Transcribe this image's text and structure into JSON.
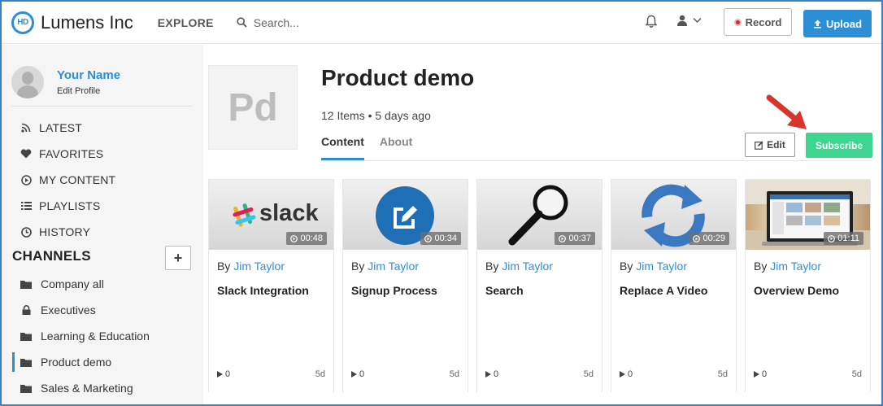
{
  "header": {
    "logo_text": "HD",
    "brand": "Lumens Inc",
    "explore_label": "EXPLORE",
    "search_placeholder": "Search...",
    "record_label": "Record",
    "upload_label": "Upload",
    "accent_color": "#2c8fd6"
  },
  "sidebar": {
    "profile": {
      "name": "Your Name",
      "edit_label": "Edit Profile"
    },
    "nav": [
      {
        "label": "LATEST",
        "icon": "rss-icon"
      },
      {
        "label": "FAVORITES",
        "icon": "heart-icon"
      },
      {
        "label": "MY CONTENT",
        "icon": "play-circle-icon"
      },
      {
        "label": "PLAYLISTS",
        "icon": "list-icon"
      },
      {
        "label": "HISTORY",
        "icon": "clock-icon"
      }
    ],
    "channels_title": "CHANNELS",
    "add_channel_label": "+",
    "channels": [
      {
        "label": "Company all",
        "icon": "folder-icon"
      },
      {
        "label": "Executives",
        "icon": "lock-icon"
      },
      {
        "label": "Learning & Education",
        "icon": "folder-icon"
      },
      {
        "label": "Product demo",
        "icon": "folder-icon",
        "active": true
      },
      {
        "label": "Sales & Marketing",
        "icon": "folder-icon"
      }
    ]
  },
  "playlist": {
    "thumb_text": "Pd",
    "title": "Product demo",
    "meta": "12 Items • 5 days ago",
    "tabs": [
      {
        "label": "Content",
        "active": true
      },
      {
        "label": "About",
        "active": false
      }
    ],
    "edit_label": "Edit",
    "subscribe_label": "Subscribe",
    "subscribe_color": "#3dd590"
  },
  "cards": [
    {
      "by": "By",
      "author": "Jim Taylor",
      "title": "Slack Integration",
      "duration": "00:48",
      "views": "0",
      "age": "5d",
      "thumb": "slack-logo"
    },
    {
      "by": "By",
      "author": "Jim Taylor",
      "title": "Signup Process",
      "duration": "00:34",
      "views": "0",
      "age": "5d",
      "thumb": "edit-circle-icon"
    },
    {
      "by": "By",
      "author": "Jim Taylor",
      "title": "Search",
      "duration": "00:37",
      "views": "0",
      "age": "5d",
      "thumb": "magnifier-icon"
    },
    {
      "by": "By",
      "author": "Jim Taylor",
      "title": "Replace A Video",
      "duration": "00:29",
      "views": "0",
      "age": "5d",
      "thumb": "refresh-arrows-icon"
    },
    {
      "by": "By",
      "author": "Jim Taylor",
      "title": "Overview Demo",
      "duration": "01:11",
      "views": "0",
      "age": "5d",
      "thumb": "laptop-screenshot"
    }
  ],
  "slack_logo_text": "slack"
}
